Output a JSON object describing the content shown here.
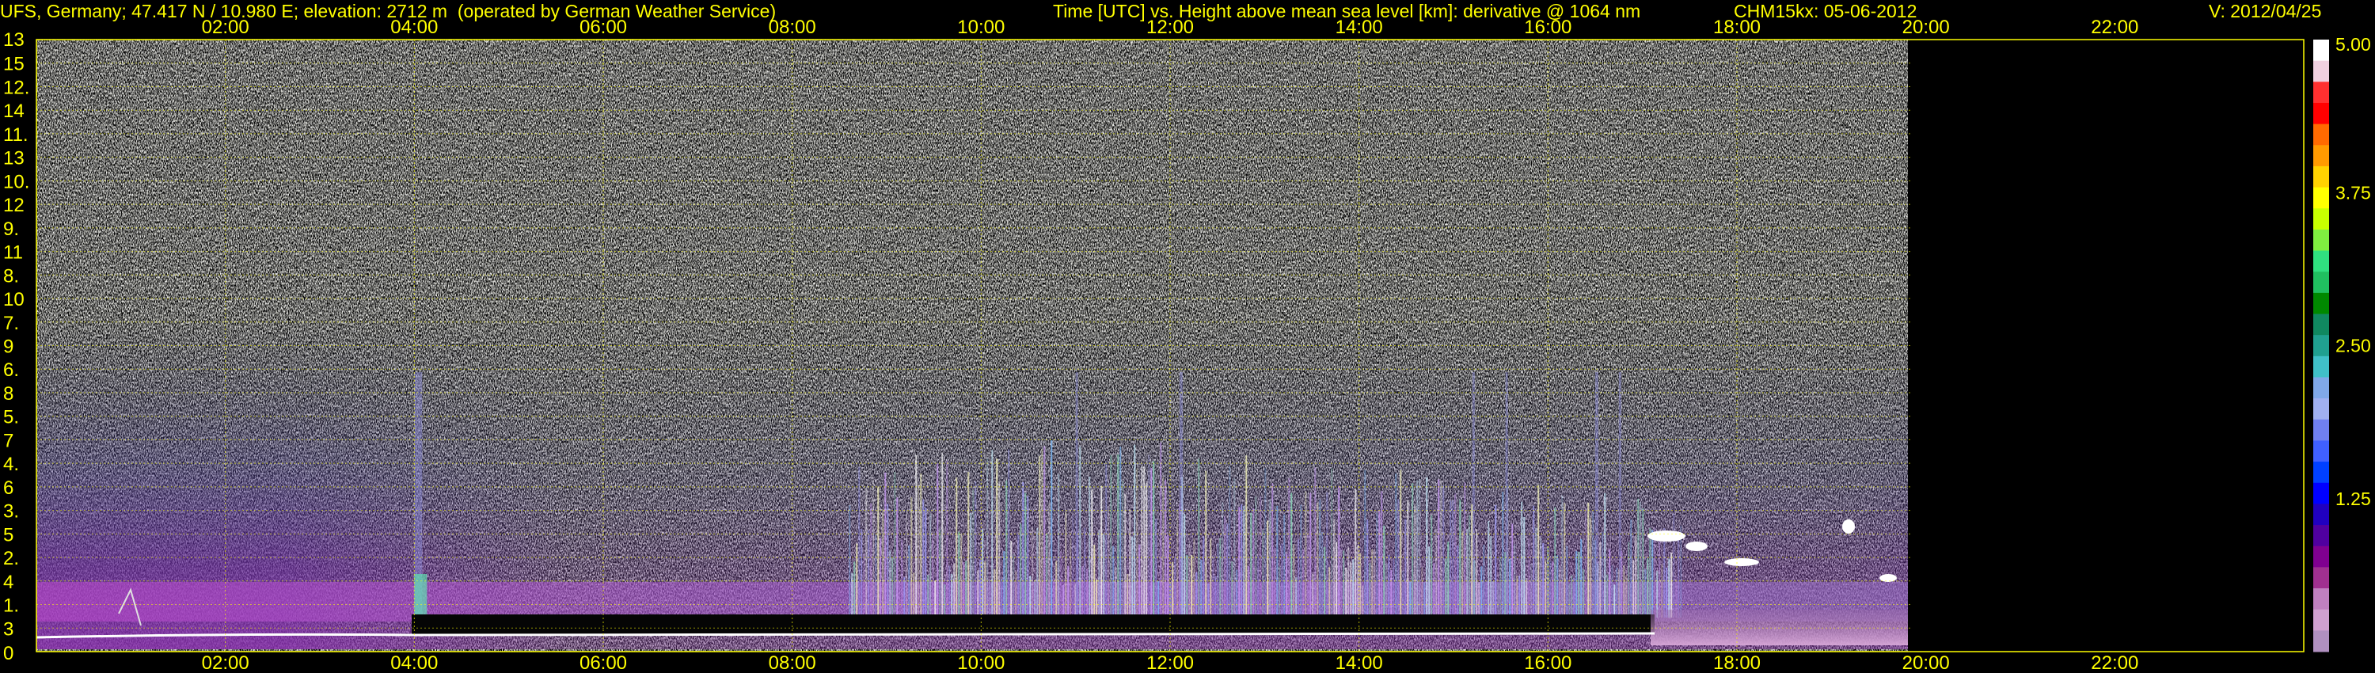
{
  "header": {
    "station": "UFS, Germany; 47.417 N / 10.980 E; elevation: 2712 m  (operated by German Weather Service)",
    "title": "Time [UTC] vs. Height above mean sea level [km]: derivative @ 1064 nm",
    "instrument": "CHM15kx: 05-06-2012",
    "version": "V: 2012/04/25"
  },
  "chart_data": {
    "type": "heatmap",
    "title": "Time [UTC] vs. Height above mean sea level [km]: derivative @ 1064 nm",
    "x_tick_labels": [
      "02:00",
      "04:00",
      "06:00",
      "08:00",
      "10:00",
      "12:00",
      "14:00",
      "16:00",
      "18:00",
      "20:00",
      "22:00"
    ],
    "x_tick_hours": [
      2,
      4,
      6,
      8,
      10,
      12,
      14,
      16,
      18,
      20,
      22
    ],
    "xlim_hours": [
      0,
      24
    ],
    "y_tick_labels": [
      "0",
      "3",
      "1.",
      "4",
      "2.",
      "5",
      "3.",
      "6",
      "4.",
      "7",
      "5.",
      "8",
      "6.",
      "9",
      "7.",
      "10",
      "8.",
      "11",
      "9.",
      "12",
      "10.",
      "13",
      "11.",
      "14",
      "12.",
      "15",
      "13"
    ],
    "colorbar": {
      "ticks": [
        "5.00",
        "3.75",
        "2.50",
        "1.25"
      ],
      "tick_values": [
        5.0,
        3.75,
        2.5,
        1.25
      ],
      "range": [
        0,
        5
      ],
      "colors": [
        "#ffffff",
        "#f0d0e0",
        "#ff3030",
        "#ff0000",
        "#ff6a00",
        "#ff9a00",
        "#ffd200",
        "#ffff00",
        "#c8ff00",
        "#80ee40",
        "#30e080",
        "#20c060",
        "#008800",
        "#108860",
        "#20a090",
        "#40c0c8",
        "#80a8e8",
        "#a0b0f0",
        "#7080f0",
        "#4060ff",
        "#0040ff",
        "#0000ff",
        "#2000c0",
        "#5000a0",
        "#800090",
        "#a03090",
        "#c080c0",
        "#d0a0d0",
        "#b090c0"
      ]
    },
    "data_end_hour": 19.85,
    "features": [
      {
        "name": "noise-field",
        "hours": [
          0,
          19.85
        ],
        "note": "high-noise signal above the boundary layer"
      },
      {
        "name": "aerosol-layer",
        "hours": [
          0,
          19.85
        ]
      },
      {
        "name": "surface-line",
        "hours": [
          0,
          17.6
        ]
      },
      {
        "name": "evening-cloud",
        "hours": [
          17.2,
          19.8
        ]
      }
    ],
    "grid": true,
    "grid_color": "#ffff00",
    "axis_color": "#ffff00"
  }
}
